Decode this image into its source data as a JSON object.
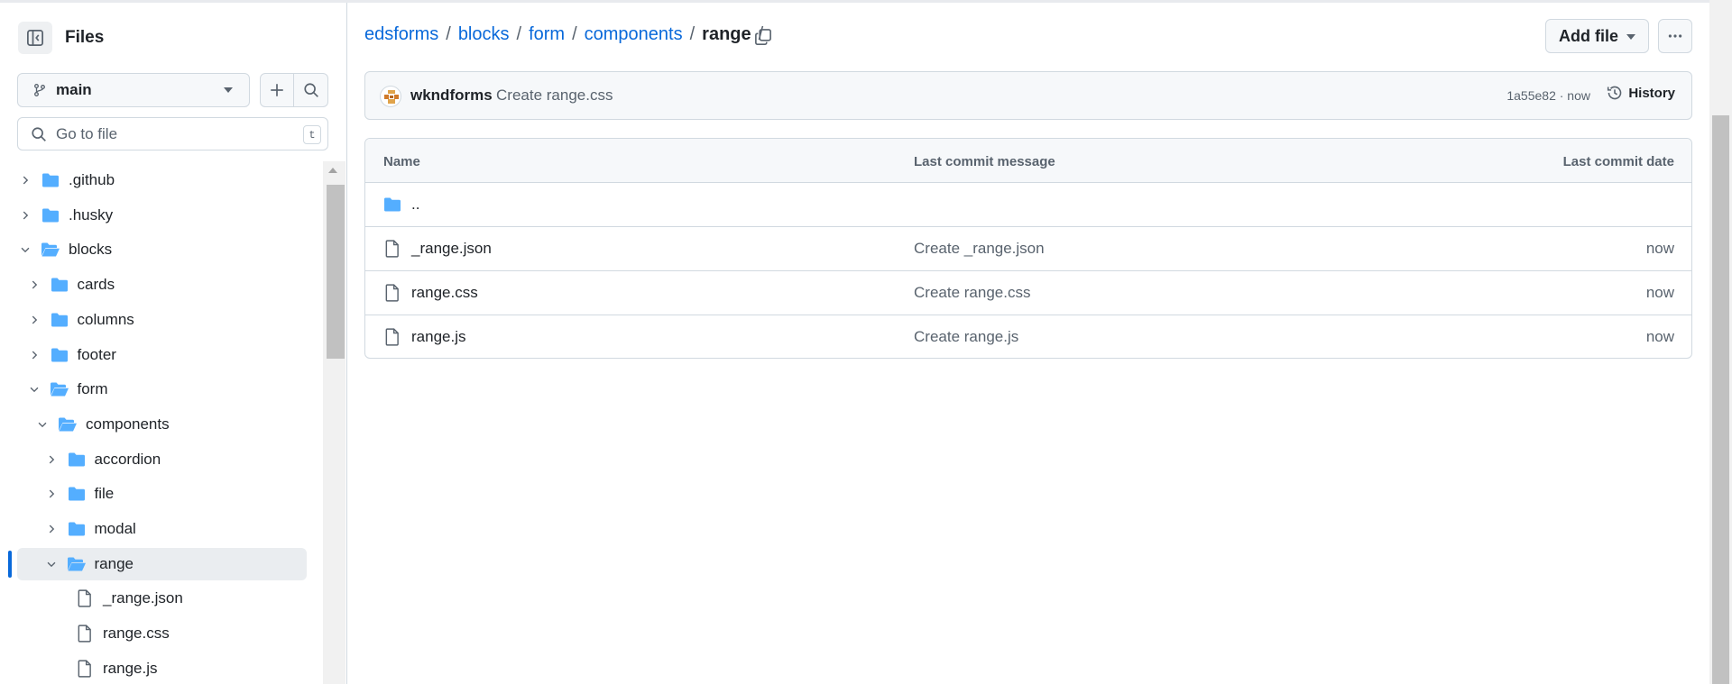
{
  "sidebar": {
    "title": "Files",
    "branch": "main",
    "search": {
      "placeholder": "Go to file",
      "shortcut": "t"
    },
    "tree": [
      {
        "label": ".github",
        "type": "folder",
        "depth": 0,
        "expanded": false
      },
      {
        "label": ".husky",
        "type": "folder",
        "depth": 0,
        "expanded": false
      },
      {
        "label": "blocks",
        "type": "folder",
        "depth": 0,
        "expanded": true
      },
      {
        "label": "cards",
        "type": "folder",
        "depth": 1,
        "expanded": false
      },
      {
        "label": "columns",
        "type": "folder",
        "depth": 1,
        "expanded": false
      },
      {
        "label": "footer",
        "type": "folder",
        "depth": 1,
        "expanded": false
      },
      {
        "label": "form",
        "type": "folder",
        "depth": 1,
        "expanded": true
      },
      {
        "label": "components",
        "type": "folder",
        "depth": 2,
        "expanded": true
      },
      {
        "label": "accordion",
        "type": "folder",
        "depth": 3,
        "expanded": false
      },
      {
        "label": "file",
        "type": "folder",
        "depth": 3,
        "expanded": false
      },
      {
        "label": "modal",
        "type": "folder",
        "depth": 3,
        "expanded": false
      },
      {
        "label": "range",
        "type": "folder",
        "depth": 3,
        "expanded": true,
        "active": true
      },
      {
        "label": "_range.json",
        "type": "file",
        "depth": 4
      },
      {
        "label": "range.css",
        "type": "file",
        "depth": 4
      },
      {
        "label": "range.js",
        "type": "file",
        "depth": 4
      }
    ]
  },
  "breadcrumb": {
    "links": [
      "edsforms",
      "blocks",
      "form",
      "components"
    ],
    "current": "range",
    "trailing_sep": "/"
  },
  "actions": {
    "add_file": "Add file"
  },
  "commit": {
    "author": "wkndforms",
    "message": "Create range.css",
    "sha_time": "1a55e82 · now",
    "history": "History"
  },
  "files": {
    "headers": {
      "name": "Name",
      "message": "Last commit message",
      "date": "Last commit date"
    },
    "parent": "..",
    "rows": [
      {
        "name": "_range.json",
        "message": "Create _range.json",
        "date": "now"
      },
      {
        "name": "range.css",
        "message": "Create range.css",
        "date": "now"
      },
      {
        "name": "range.js",
        "message": "Create range.js",
        "date": "now"
      }
    ]
  },
  "colors": {
    "link": "#0969da",
    "folder": "#54aeff",
    "border": "#d1d9e0",
    "muted": "#59636e"
  }
}
